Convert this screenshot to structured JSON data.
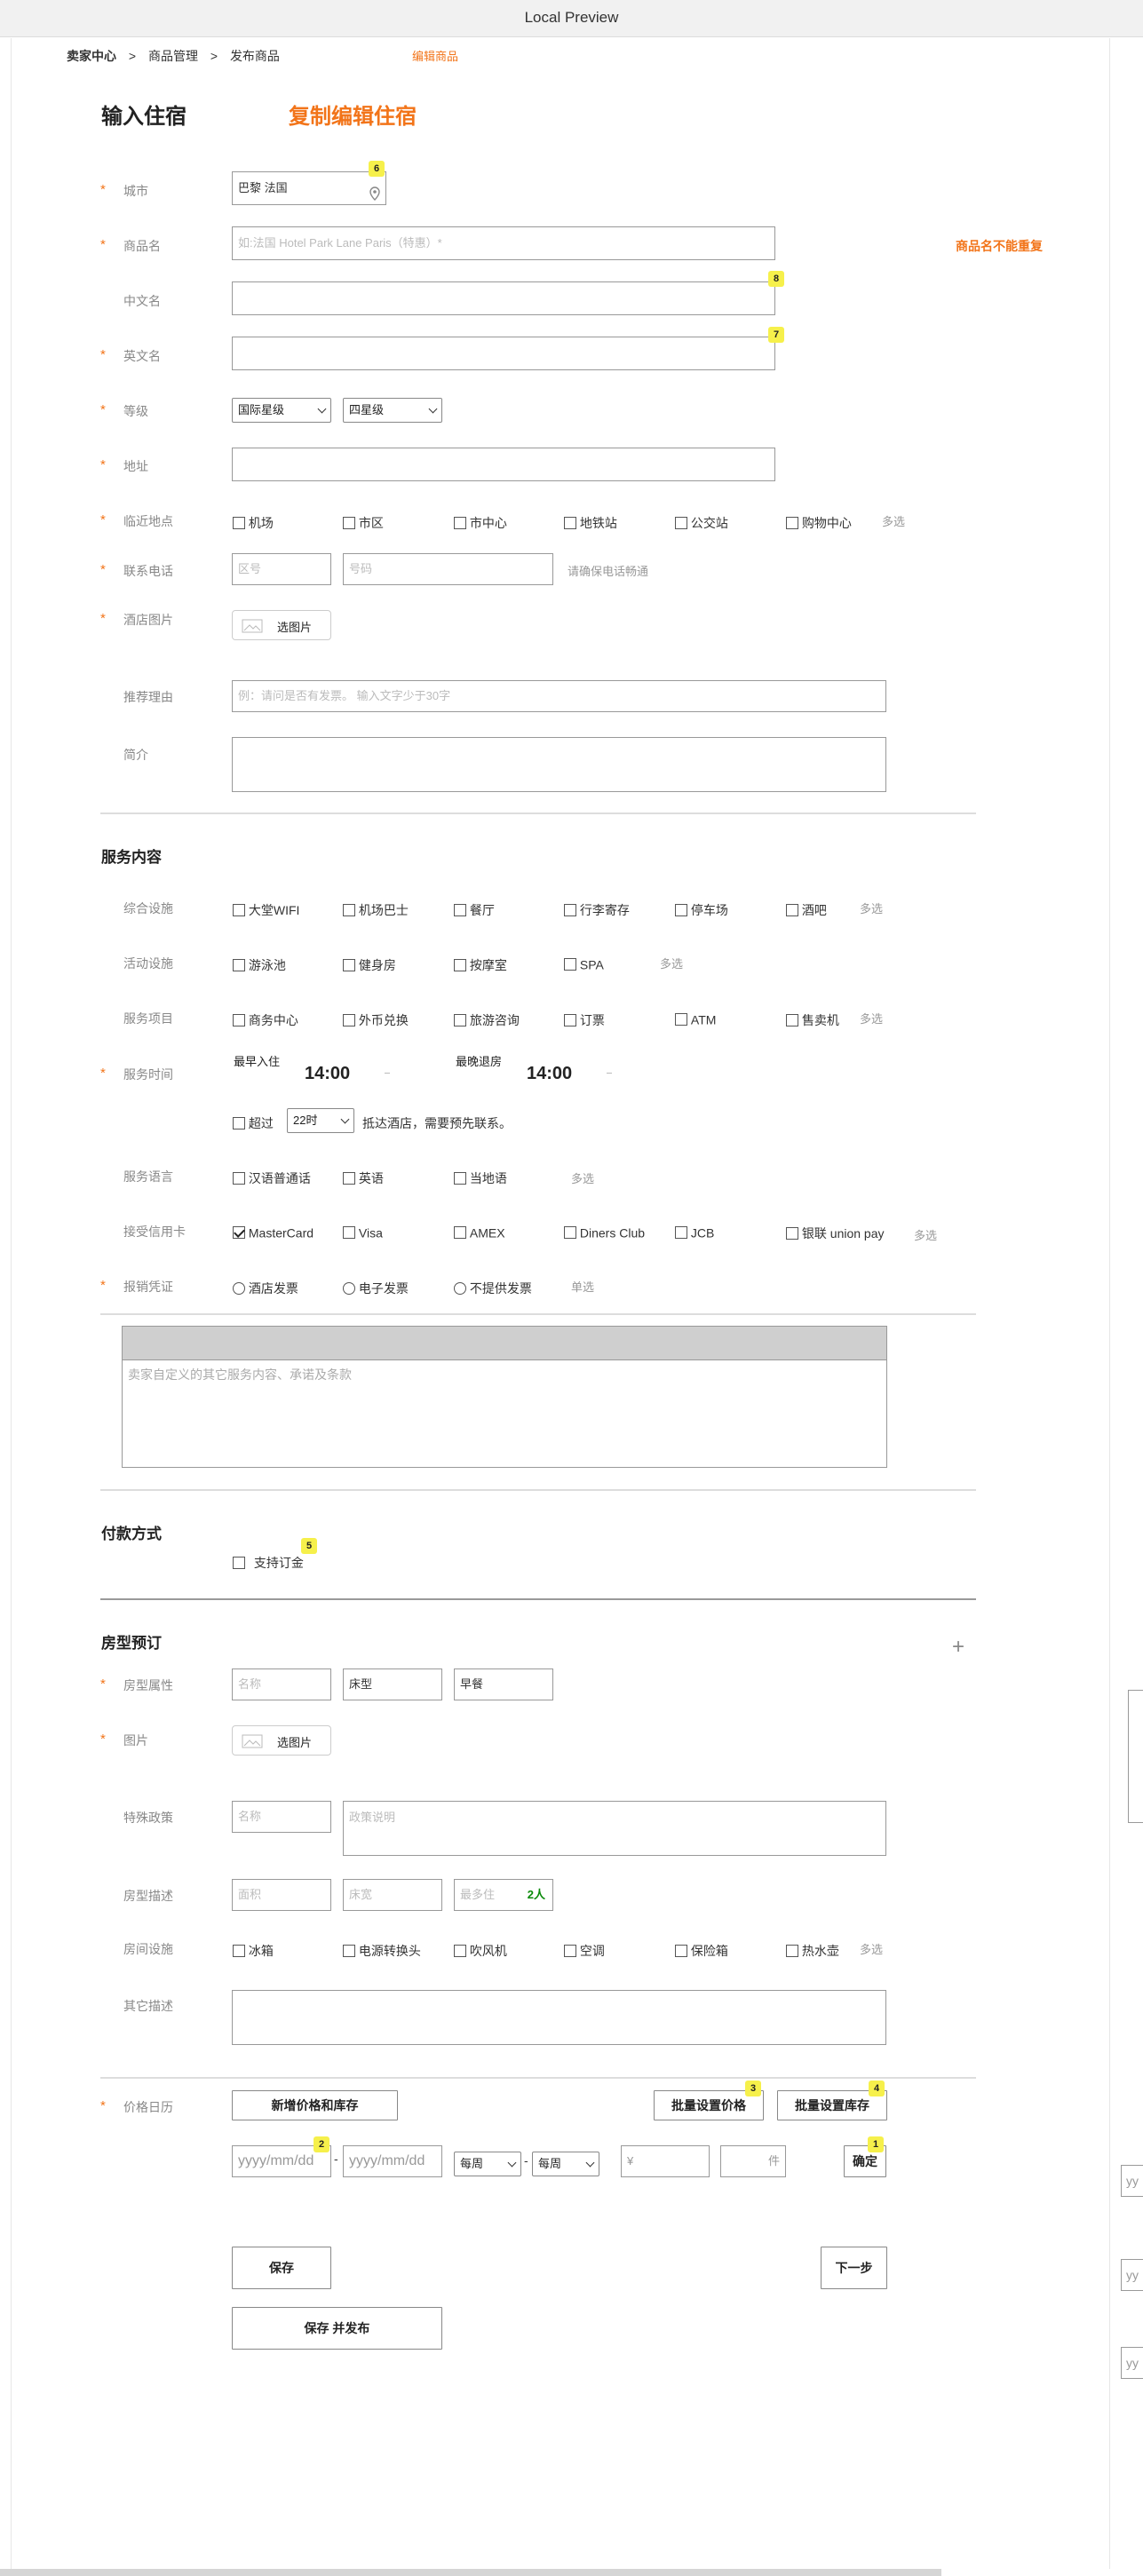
{
  "window": {
    "title": "Local Preview"
  },
  "breadcrumb": {
    "home": "卖家中心",
    "sep1": ">",
    "mgmt": "商品管理",
    "sep2": ">",
    "publish": "发布商品",
    "edit": "编辑商品"
  },
  "header": {
    "title": "输入住宿",
    "copy": "复制编辑住宿"
  },
  "badges": {
    "b1": "1",
    "b2": "2",
    "b3": "3",
    "b4": "4",
    "b5": "5",
    "b6": "6",
    "b7": "7",
    "b8": "8"
  },
  "basic": {
    "city_label": "城市",
    "city_value": "巴黎  法国",
    "name_label": "商品名",
    "name_placeholder": "如:法国 Hotel Park Lane Paris（特惠）*",
    "name_tip": "商品名不能重复",
    "cn_label": "中文名",
    "en_label": "英文名",
    "level_label": "等级",
    "level_sel1": "国际星级",
    "level_sel2": "四星级",
    "addr_label": "地址",
    "nearby_label": "临近地点",
    "nearby": [
      "机场",
      "市区",
      "市中心",
      "地铁站",
      "公交站",
      "购物中心"
    ],
    "nearby_hint": "多选",
    "phone_label": "联系电话",
    "phone_area": "区号",
    "phone_num": "号码",
    "phone_hint": "请确保电话畅通",
    "photo_label": "酒店图片",
    "photo_btn": "选图片",
    "reason_label": "推荐理由",
    "reason_placeholder": "例：请问是否有发票。 输入文字少于30字",
    "intro_label": "简介"
  },
  "service": {
    "title": "服务内容",
    "facility_label": "综合设施",
    "facility": [
      "大堂WIFI",
      "机场巴士",
      "餐厅",
      "行李寄存",
      "停车场",
      "酒吧"
    ],
    "facility_hint": "多选",
    "activity_label": "活动设施",
    "activity": [
      "游泳池",
      "健身房",
      "按摩室",
      "SPA"
    ],
    "activity_hint": "多选",
    "items_label": "服务项目",
    "items": [
      "商务中心",
      "外币兑换",
      "旅游咨询",
      "订票",
      "ATM",
      "售卖机"
    ],
    "items_hint": "多选",
    "time_label": "服务时间",
    "checkin_label": "最早入住",
    "checkin": "14:00",
    "checkout_label": "最晚退房",
    "checkout": "14:00",
    "over_label": "超过",
    "over_sel": "22时",
    "over_tip": "抵达酒店，需要预先联系。",
    "lang_label": "服务语言",
    "langs": [
      "汉语普通话",
      "英语",
      "当地语"
    ],
    "lang_hint": "多选",
    "card_label": "接受信用卡",
    "cards": [
      "MasterCard",
      "Visa",
      "AMEX",
      "Diners Club",
      "JCB",
      "银联 union pay"
    ],
    "card_hint": "多选",
    "invoice_label": "报销凭证",
    "invoices": [
      "酒店发票",
      "电子发票",
      "不提供发票"
    ],
    "invoice_hint": "单选",
    "custom_placeholder": "卖家自定义的其它服务内容、承诺及条款"
  },
  "payment": {
    "title": "付款方式",
    "deposit": "支持订金"
  },
  "room": {
    "title": "房型预订",
    "add_icon": "+",
    "attr_label": "房型属性",
    "attr_name": "名称",
    "attr_bed": "床型",
    "attr_meal": "早餐",
    "pic_label": "图片",
    "pic_btn": "选图片",
    "policy_label": "特殊政策",
    "policy_name": "名称",
    "policy_desc": "政策说明",
    "desc_label": "房型描述",
    "area": "面积",
    "bed_width": "床宽",
    "max_live": "最多住",
    "max_value": "2人",
    "equip_label": "房间设施",
    "equip": [
      "冰箱",
      "电源转换头",
      "吹风机",
      "空调",
      "保险箱",
      "热水壶"
    ],
    "equip_hint": "多选",
    "other_label": "其它描述"
  },
  "price": {
    "label": "价格日历",
    "add_btn": "新增价格和库存",
    "batch_price": "批量设置价格",
    "batch_stock": "批量设置库存",
    "date_ph": "yyyy/mm/dd",
    "dash": "-",
    "week1": "每周",
    "week2": "每周",
    "yuan": "¥",
    "unit": "件",
    "confirm": "确定"
  },
  "actions": {
    "save": "保存",
    "next": "下一步",
    "save_publish": "保存 并发布"
  },
  "right_edge": {
    "d1": "yy",
    "d2": "yy",
    "d3": "yy"
  }
}
